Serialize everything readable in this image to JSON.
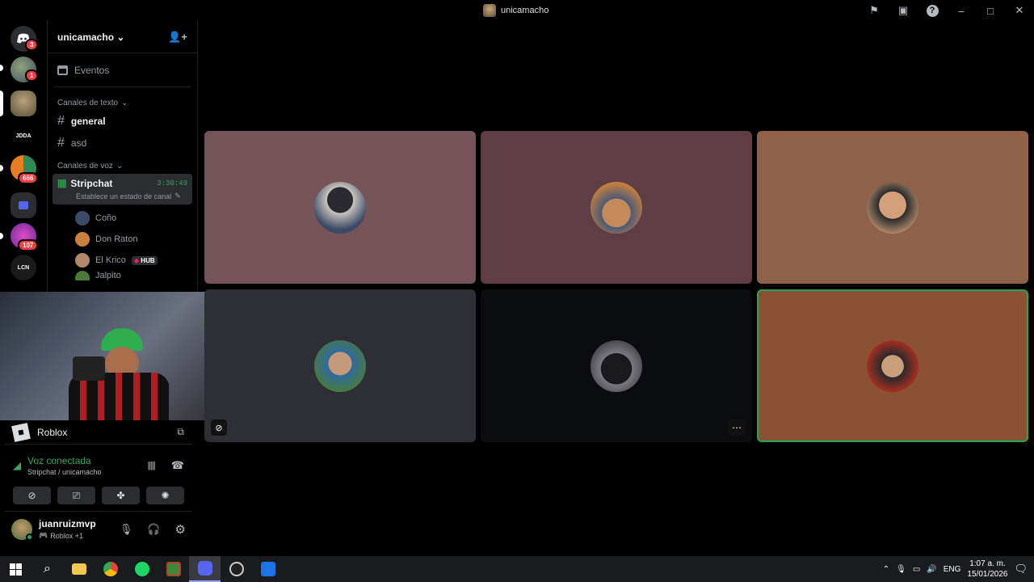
{
  "window": {
    "title": "unicamacho",
    "icons": [
      "flag-icon",
      "inbox-icon",
      "help-icon",
      "minimize-icon",
      "maximize-icon",
      "close-icon"
    ]
  },
  "server_rail": {
    "badges": {
      "dm": "3",
      "server1": "1",
      "server5": "666",
      "server7": "107"
    },
    "labels": {
      "jdda": "JDDA",
      "lcn": "LCN"
    }
  },
  "server": {
    "name": "unicamacho",
    "events_label": "Eventos",
    "text_category": "Canales de texto",
    "text_channels": [
      {
        "name": "general",
        "active": true
      },
      {
        "name": "asd",
        "active": false
      }
    ],
    "voice_category": "Canales de voz",
    "voice_channel": {
      "name": "Stripchat",
      "timer": "3:30:49",
      "status_placeholder": "Establece un estado de canal"
    },
    "voice_users": [
      {
        "name": "Coño",
        "badge": ""
      },
      {
        "name": "Don Raton",
        "badge": ""
      },
      {
        "name": "El Krico",
        "badge": "HUB"
      },
      {
        "name": "Jalpito",
        "badge": ""
      }
    ]
  },
  "panel": {
    "activity": "Roblox",
    "voice_status": "Voz conectada",
    "voice_location": "Stripchat / unicamacho",
    "user_name": "juanruizmvp",
    "user_activity": "Roblox +1"
  },
  "tiles": [
    {
      "bg": "#76555a",
      "avatar": "#3b4a66"
    },
    {
      "bg": "#5e3e44",
      "avatar": "#c9803a"
    },
    {
      "bg": "#8f6149",
      "avatar": "#b08a6b"
    },
    {
      "bg": "#2e2f34",
      "avatar": "#4a7a3a"
    },
    {
      "bg": "#0b0c10",
      "avatar": "#3e3e44"
    },
    {
      "bg": "#8a5233",
      "avatar": "#4b3a2c",
      "speaking": true
    }
  ],
  "taskbar": {
    "language": "ENG",
    "time": "1:07 a. m.",
    "date": "15/01/2026"
  },
  "colors": {
    "accent_green": "#23a55a",
    "badge_red": "#f23f43",
    "voice_green": "#3ba55c"
  }
}
